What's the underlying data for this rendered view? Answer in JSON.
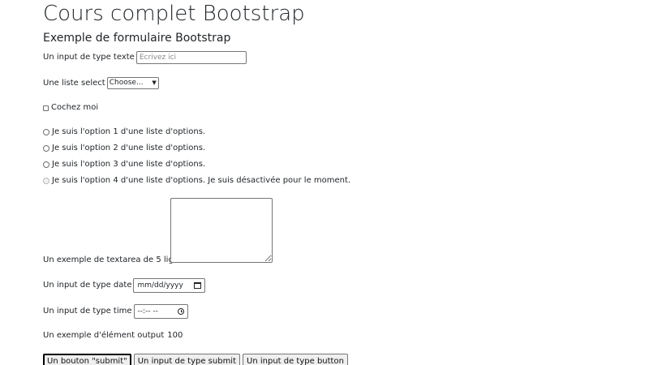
{
  "header": {
    "title": "Cours complet Bootstrap",
    "subtitle": "Exemple de formulaire Bootstrap"
  },
  "form": {
    "text_input": {
      "label": "Un input de type texte",
      "placeholder": "Ecrivez ici",
      "value": ""
    },
    "select": {
      "label": "Une liste select",
      "selected": "Choose..."
    },
    "checkbox": {
      "label": "Cochez moi",
      "checked": false
    },
    "radios": [
      {
        "label": "Je suis l'option 1 d'une liste d'options.",
        "disabled": false
      },
      {
        "label": "Je suis l'option 2 d'une liste d'options.",
        "disabled": false
      },
      {
        "label": "Je suis l'option 3 d'une liste d'options.",
        "disabled": false
      },
      {
        "label": "Je suis l'option 4 d'une liste d'options. Je suis désactivée pour le moment.",
        "disabled": true
      }
    ],
    "textarea": {
      "label": "Un exemple de textarea de 5 lignes",
      "value": ""
    },
    "date_input": {
      "label": "Un input de type date",
      "placeholder": "mm/dd/yyyy"
    },
    "time_input": {
      "label": "Un input de type time",
      "placeholder": "--:-- --"
    },
    "output": {
      "label": "Un exemple d'élément output",
      "value": "100"
    },
    "buttons": {
      "submit_button": "Un bouton \"submit\"",
      "input_submit": "Un input de type submit",
      "input_button": "Un input de type button"
    }
  }
}
